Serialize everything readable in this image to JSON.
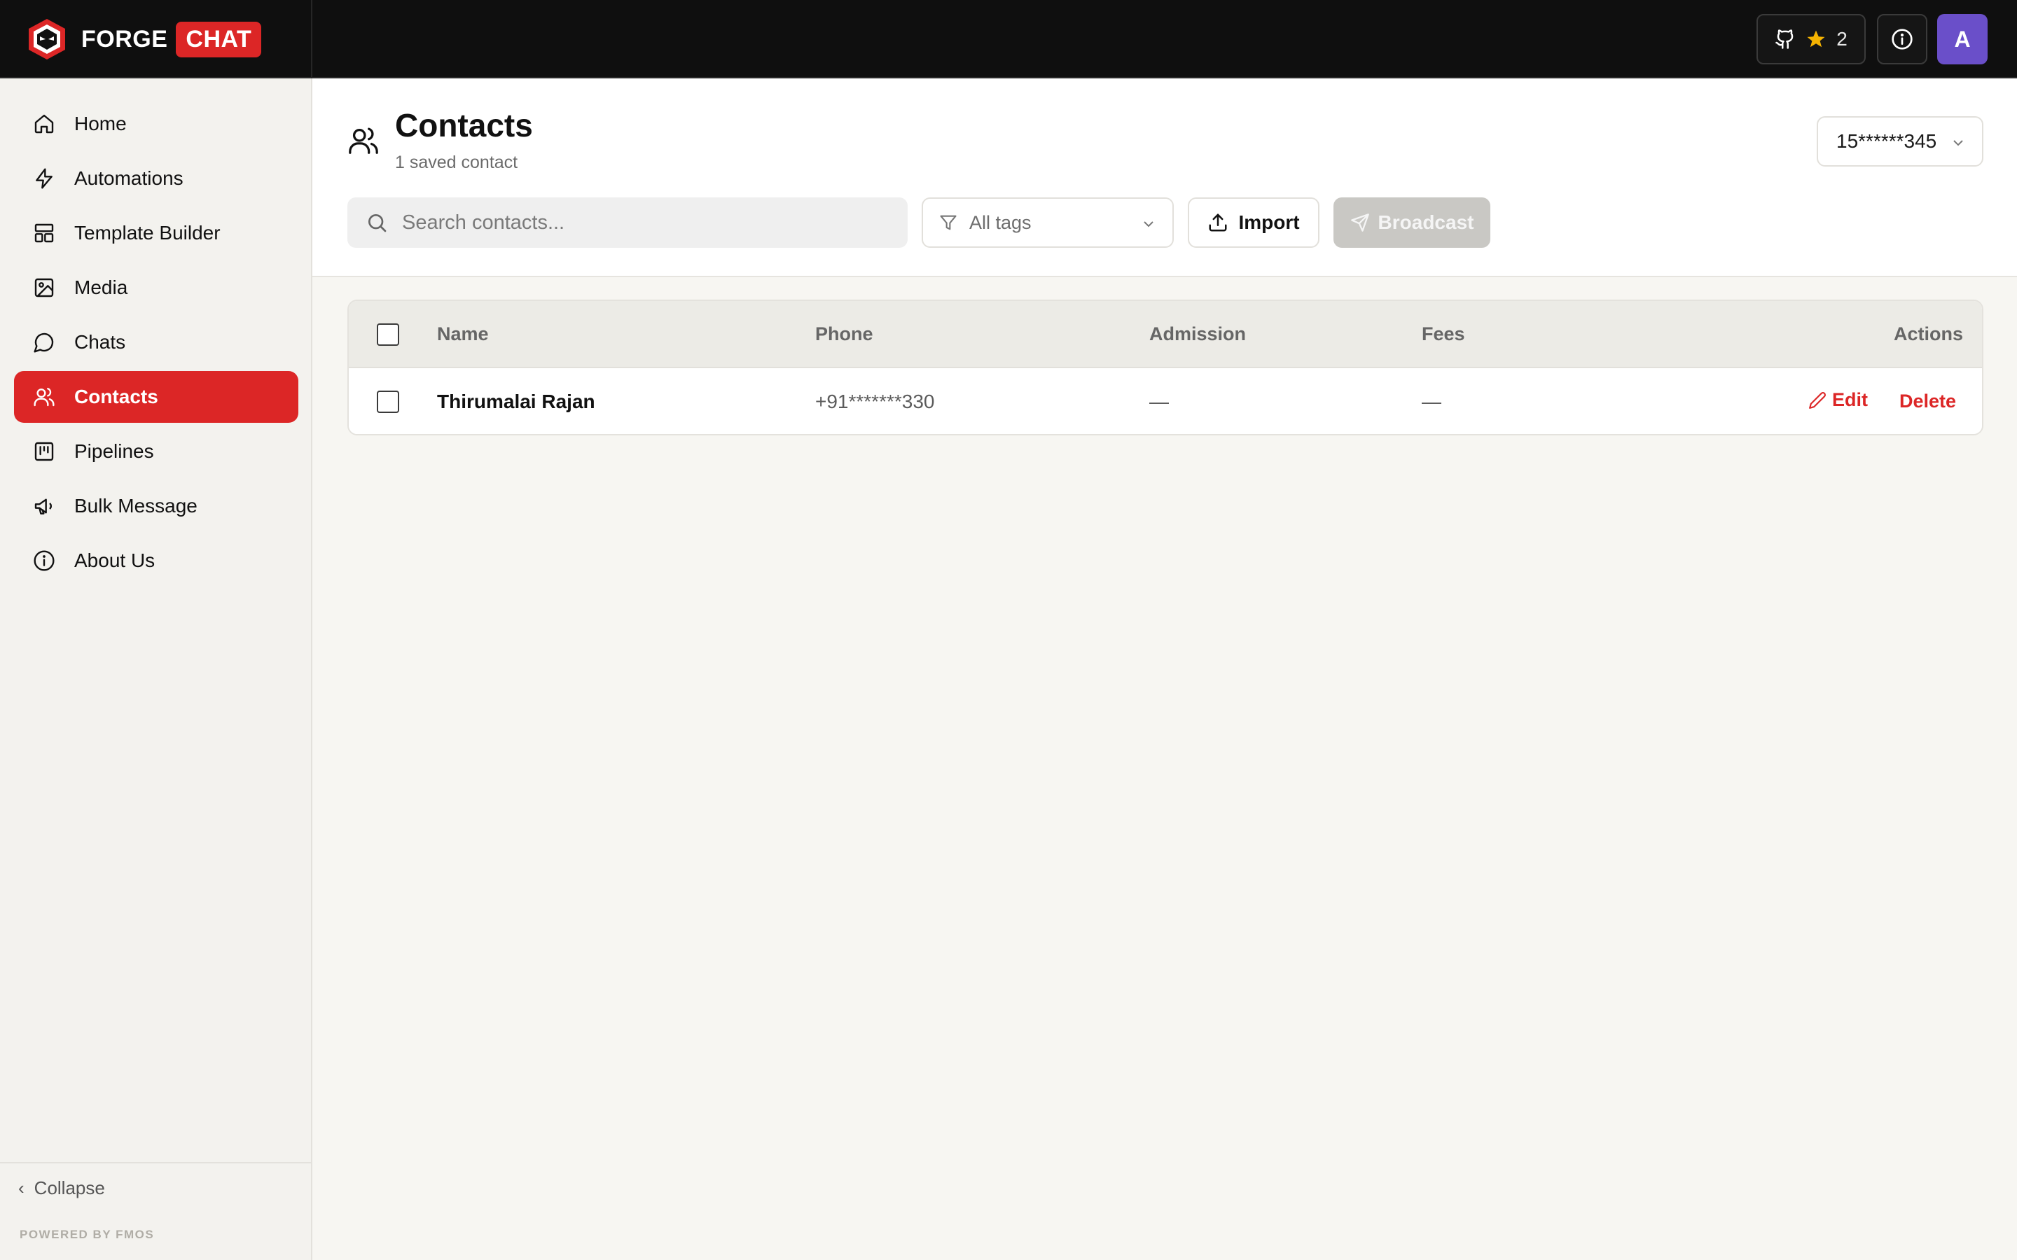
{
  "brand": {
    "name": "FORGE",
    "badge": "CHAT"
  },
  "topbar": {
    "star_count": "2",
    "avatar_initial": "A"
  },
  "sidebar": {
    "items": [
      {
        "label": "Home",
        "icon": "home-icon"
      },
      {
        "label": "Automations",
        "icon": "zap-icon"
      },
      {
        "label": "Template Builder",
        "icon": "layout-icon"
      },
      {
        "label": "Media",
        "icon": "image-icon"
      },
      {
        "label": "Chats",
        "icon": "chat-icon"
      },
      {
        "label": "Contacts",
        "icon": "users-icon",
        "active": true
      },
      {
        "label": "Pipelines",
        "icon": "kanban-icon"
      },
      {
        "label": "Bulk Message",
        "icon": "megaphone-icon"
      },
      {
        "label": "About Us",
        "icon": "info-icon"
      }
    ],
    "collapse_label": "Collapse",
    "powered_by": "POWERED BY FMOS"
  },
  "header": {
    "title": "Contacts",
    "subtitle": "1 saved contact",
    "phone_select": "15******345"
  },
  "toolbar": {
    "search_placeholder": "Search contacts...",
    "tags_value": "All tags",
    "import_label": "Import",
    "broadcast_label": "Broadcast"
  },
  "table": {
    "columns": [
      "Name",
      "Phone",
      "Admission",
      "Fees",
      "Actions"
    ],
    "rows": [
      {
        "name": "Thirumalai Rajan",
        "phone": "+91*******330",
        "admission": "—",
        "fees": "—",
        "edit": "Edit",
        "delete": "Delete"
      }
    ]
  },
  "colors": {
    "accent": "#dc2626",
    "topbar": "#0f0f0f",
    "avatar": "#6a4fc9",
    "star": "#f5b301"
  }
}
